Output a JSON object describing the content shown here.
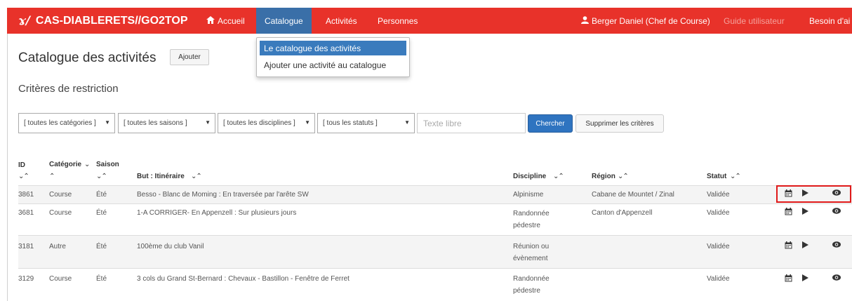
{
  "nav": {
    "brand_logo": "ɤ/",
    "brand": "CAS-DIABLERETS//GO2TOP",
    "home_icon": "home-icon",
    "home": "Accueil",
    "catalogue": "Catalogue",
    "activities": "Activités",
    "people": "Personnes",
    "user_icon": "user-icon",
    "user": "Berger Daniel (Chef de Course)",
    "guide": "Guide utilisateur",
    "help": "Besoin d'ai"
  },
  "dropdown": {
    "items": [
      "Le catalogue des activités",
      "Ajouter une activité au catalogue"
    ]
  },
  "page": {
    "title": "Catalogue des activités",
    "add_button": "Ajouter",
    "subtitle": "Critères de restriction"
  },
  "filters": {
    "category": "[ toutes les catégories ]",
    "season": "[ toutes les saisons ]",
    "discipline": "[ toutes les disciplines ]",
    "status": "[ tous les statuts ]",
    "text_placeholder": "Texte libre",
    "search_button": "Chercher",
    "clear_button": "Supprimer les critères"
  },
  "table": {
    "headers": {
      "id": "ID",
      "category": "Catégorie",
      "season": "Saison",
      "goal": "But : Itinéraire",
      "discipline": "Discipline",
      "region": "Région",
      "status": "Statut"
    },
    "sort_both": "⌄⌃",
    "sort_down": "⌄",
    "sort_up": "⌃",
    "rows": [
      {
        "id": "3861",
        "category": "Course",
        "season": "Été",
        "goal": "Besso - Blanc de Moming : En traversée par l'arête SW",
        "discipline": "Alpinisme",
        "region": "Cabane de Mountet / Zinal",
        "status": "Validée"
      },
      {
        "id": "3681",
        "category": "Course",
        "season": "Été",
        "goal": "1-A CORRIGER- En Appenzell : Sur plusieurs jours",
        "discipline": "Randonnée pédestre",
        "region": "Canton d'Appenzell",
        "status": "Validée"
      },
      {
        "id": "3181",
        "category": "Autre",
        "season": "Été",
        "goal": "100ème du club Vanil",
        "discipline": "Réunion ou évènement",
        "region": "",
        "status": "Validée"
      },
      {
        "id": "3129",
        "category": "Course",
        "season": "Été",
        "goal": "3 cols du Grand St-Bernard : Chevaux - Bastillon - Fenêtre de Ferret",
        "discipline": "Randonnée pédestre",
        "region": "",
        "status": "Validée"
      }
    ],
    "actions": {
      "calendar": "calendar-icon",
      "play": "play-icon",
      "view": "eye-icon"
    }
  }
}
